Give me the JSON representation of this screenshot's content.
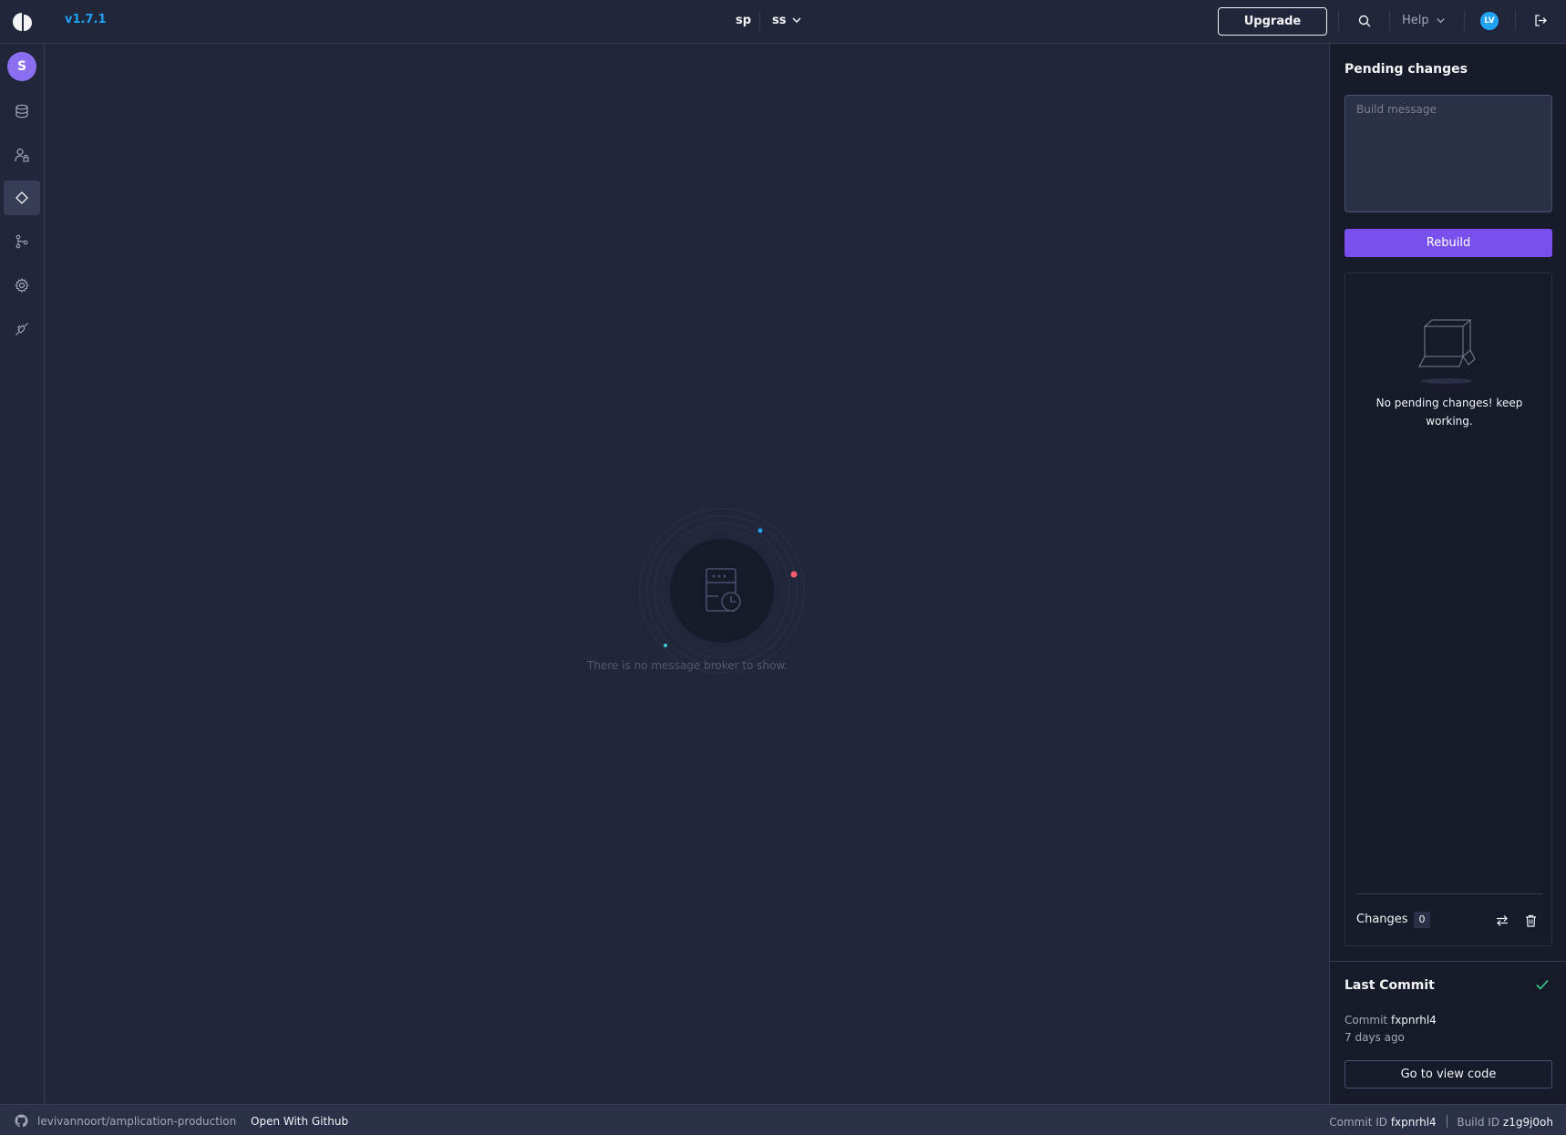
{
  "header": {
    "version": "v1.7.1",
    "workspace": "sp",
    "project": "ss",
    "upgrade_label": "Upgrade",
    "help_label": "Help",
    "user_initials": "LV"
  },
  "sidebar": {
    "workspace_initial": "S",
    "items": [
      {
        "icon": "database-icon"
      },
      {
        "icon": "user-lock-icon"
      },
      {
        "icon": "diamond-icon",
        "active": true
      },
      {
        "icon": "git-branch-icon"
      },
      {
        "icon": "gear-icon"
      },
      {
        "icon": "plug-icon"
      }
    ]
  },
  "main": {
    "empty_message": "There is no message broker to show."
  },
  "pending": {
    "title": "Pending changes",
    "build_message_placeholder": "Build message",
    "rebuild_label": "Rebuild",
    "no_changes_text": "No pending changes! keep working.",
    "changes_label": "Changes",
    "changes_count": "0"
  },
  "last_commit": {
    "title": "Last Commit",
    "commit_label": "Commit",
    "commit_id": "fxpnrhl4",
    "when": "7 days ago",
    "view_code_label": "Go to view code"
  },
  "footer": {
    "repo": "levivannoort/amplication-production",
    "open_github_label": "Open With Github",
    "commit_id_label": "Commit ID",
    "commit_id": "fxpnrhl4",
    "build_id_label": "Build ID",
    "build_id": "z1g9j0oh"
  },
  "colors": {
    "background": "#22263a",
    "panel": "#171a29",
    "accent": "#7950ed",
    "link": "#20a4f3",
    "success": "#30d58e"
  }
}
